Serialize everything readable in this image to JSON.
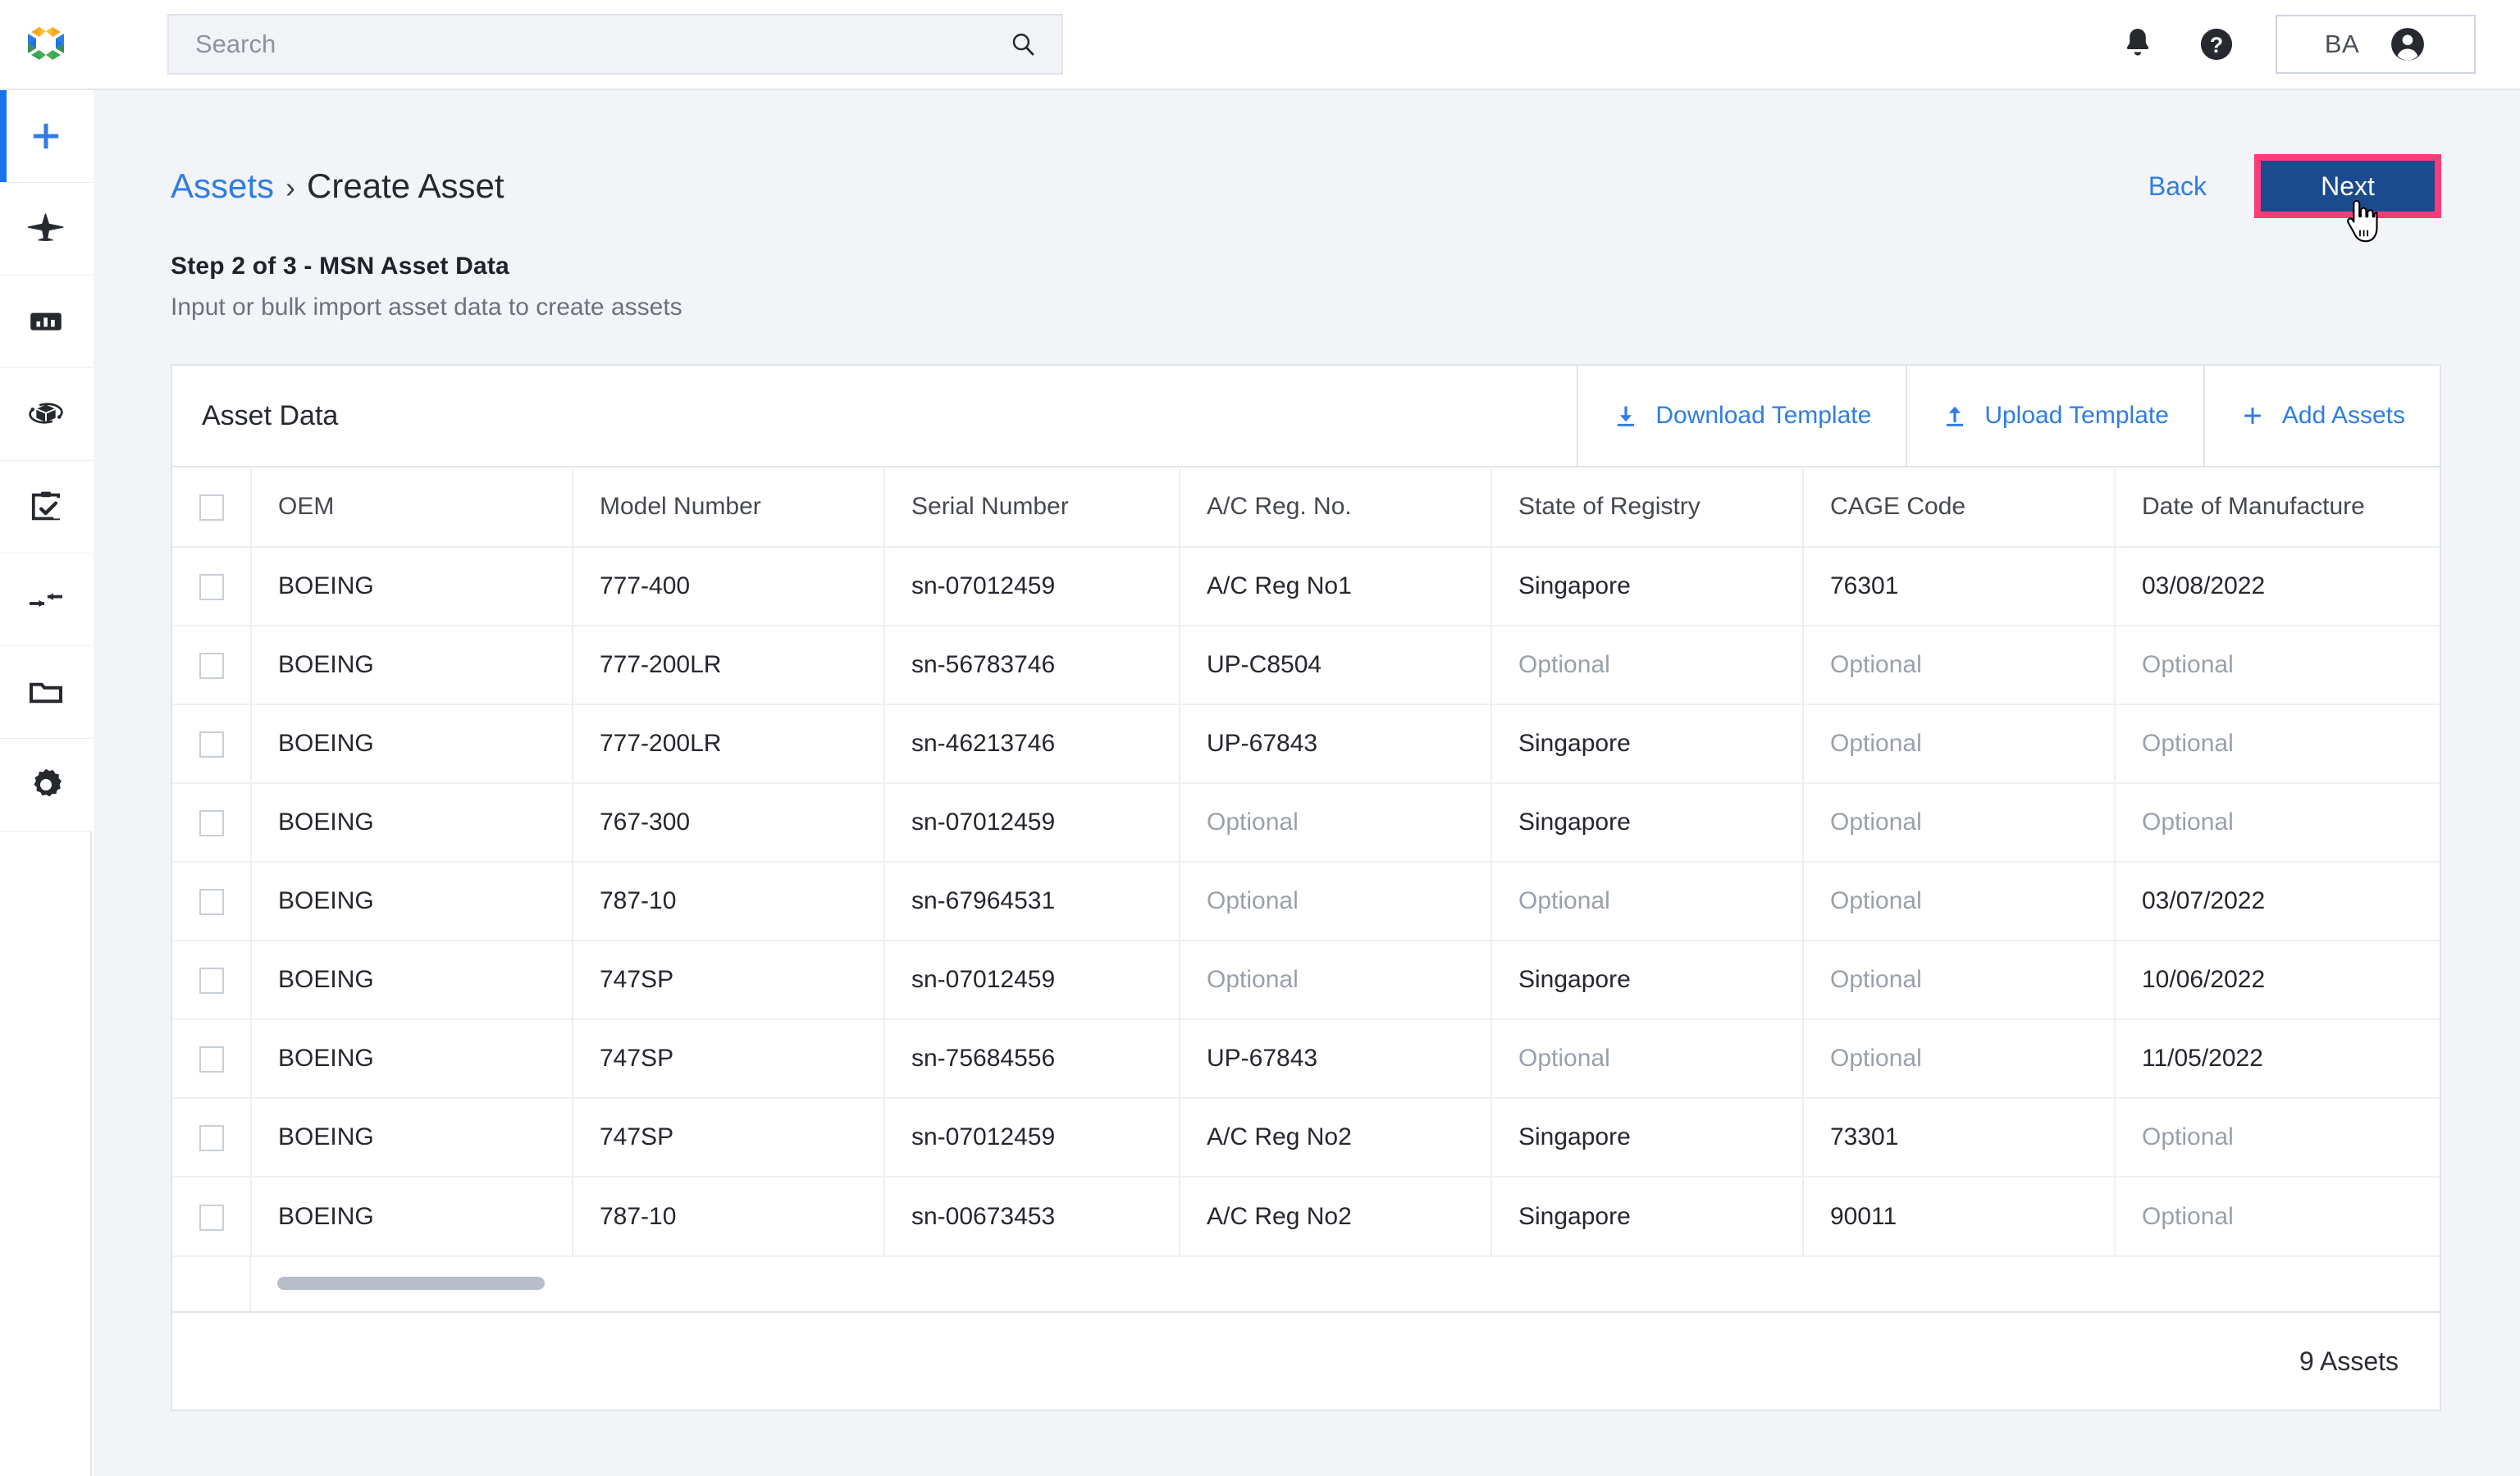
{
  "topbar": {
    "logo_name": "app-logo",
    "search": {
      "placeholder": "Search",
      "value": "",
      "icon": "search-icon"
    },
    "notifications_icon": "bell-icon",
    "help_icon": "help-circle-icon",
    "account": {
      "initials": "BA",
      "avatar_icon": "account-circle-icon"
    }
  },
  "sidebar": {
    "items": [
      {
        "name": "add",
        "icon": "plus-icon",
        "active": true
      },
      {
        "name": "aircraft",
        "icon": "airplane-icon",
        "active": false
      },
      {
        "name": "dashboard",
        "icon": "chart-bar-icon",
        "active": false
      },
      {
        "name": "inventory",
        "icon": "package-rotate-icon",
        "active": false
      },
      {
        "name": "tasks",
        "icon": "clipboard-check-icon",
        "active": false
      },
      {
        "name": "transfers",
        "icon": "transfer-arrows-icon",
        "active": false
      },
      {
        "name": "files",
        "icon": "folder-icon",
        "active": false
      },
      {
        "name": "settings",
        "icon": "gear-icon",
        "active": false
      }
    ]
  },
  "page": {
    "breadcrumb": {
      "parent": "Assets",
      "separator": "›",
      "current": "Create Asset"
    },
    "back_label": "Back",
    "next_label": "Next",
    "step_title": "Step 2 of 3 - MSN Asset Data",
    "step_subtitle": "Input or bulk import asset data to create assets",
    "highlight_color": "#f93e77",
    "next_button_color": "#1b4b8f",
    "link_color": "#2f7de1"
  },
  "card": {
    "title": "Asset Data",
    "actions": [
      {
        "label": "Download Template",
        "icon": "download-icon"
      },
      {
        "label": "Upload Template",
        "icon": "upload-icon"
      },
      {
        "label": "Add Assets",
        "icon": "plus-icon"
      }
    ],
    "footer_count": "9 Assets"
  },
  "table": {
    "columns": [
      "OEM",
      "Model Number",
      "Serial Number",
      "A/C Reg. No.",
      "State of Registry",
      "CAGE Code",
      "Date of Manufacture"
    ],
    "optional_placeholder": "Optional",
    "rows": [
      {
        "checked": false,
        "cells": [
          "BOEING",
          "777-400",
          "sn-07012459",
          "A/C Reg No1",
          "Singapore",
          "76301",
          "03/08/2022"
        ]
      },
      {
        "checked": false,
        "cells": [
          "BOEING",
          "777-200LR",
          "sn-56783746",
          "UP-C8504",
          "Optional",
          "Optional",
          "Optional"
        ]
      },
      {
        "checked": false,
        "cells": [
          "BOEING",
          "777-200LR",
          "sn-46213746",
          "UP-67843",
          "Singapore",
          "Optional",
          "Optional"
        ]
      },
      {
        "checked": false,
        "cells": [
          "BOEING",
          "767-300",
          "sn-07012459",
          "Optional",
          "Singapore",
          "Optional",
          "Optional"
        ]
      },
      {
        "checked": false,
        "cells": [
          "BOEING",
          "787-10",
          "sn-67964531",
          "Optional",
          "Optional",
          "Optional",
          "03/07/2022"
        ]
      },
      {
        "checked": false,
        "cells": [
          "BOEING",
          "747SP",
          "sn-07012459",
          "Optional",
          "Singapore",
          "Optional",
          "10/06/2022"
        ]
      },
      {
        "checked": false,
        "cells": [
          "BOEING",
          "747SP",
          "sn-75684556",
          "UP-67843",
          "Optional",
          "Optional",
          "11/05/2022"
        ]
      },
      {
        "checked": false,
        "cells": [
          "BOEING",
          "747SP",
          "sn-07012459",
          "A/C Reg No2",
          "Singapore",
          "73301",
          "Optional"
        ]
      },
      {
        "checked": false,
        "cells": [
          "BOEING",
          "787-10",
          "sn-00673453",
          "A/C Reg No2",
          "Singapore",
          "90011",
          "Optional"
        ]
      }
    ]
  }
}
